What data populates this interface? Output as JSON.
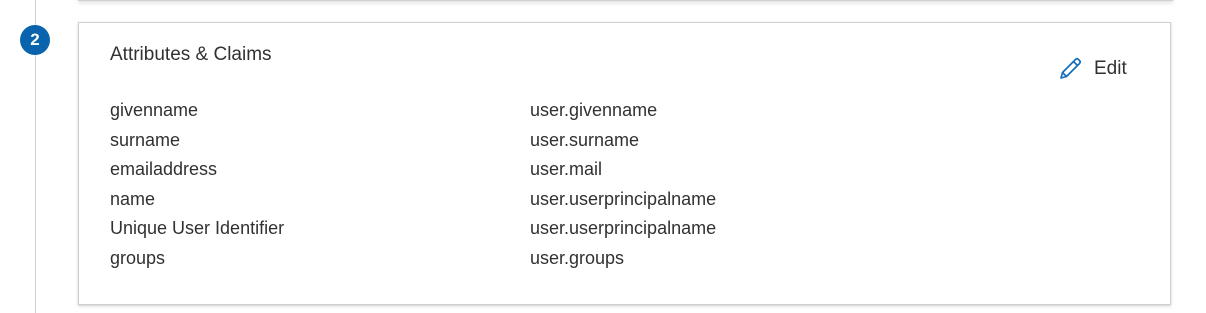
{
  "step": {
    "number": "2"
  },
  "card": {
    "title": "Attributes & Claims",
    "edit_label": "Edit",
    "edit_icon": "pencil-icon"
  },
  "claims": [
    {
      "name": "givenname",
      "value": "user.givenname"
    },
    {
      "name": "surname",
      "value": "user.surname"
    },
    {
      "name": "emailaddress",
      "value": "user.mail"
    },
    {
      "name": "name",
      "value": "user.userprincipalname"
    },
    {
      "name": "Unique User Identifier",
      "value": "user.userprincipalname"
    },
    {
      "name": "groups",
      "value": "user.groups"
    }
  ],
  "colors": {
    "accent": "#0f6cbd",
    "text": "#323130",
    "border": "#d2d0ce"
  }
}
